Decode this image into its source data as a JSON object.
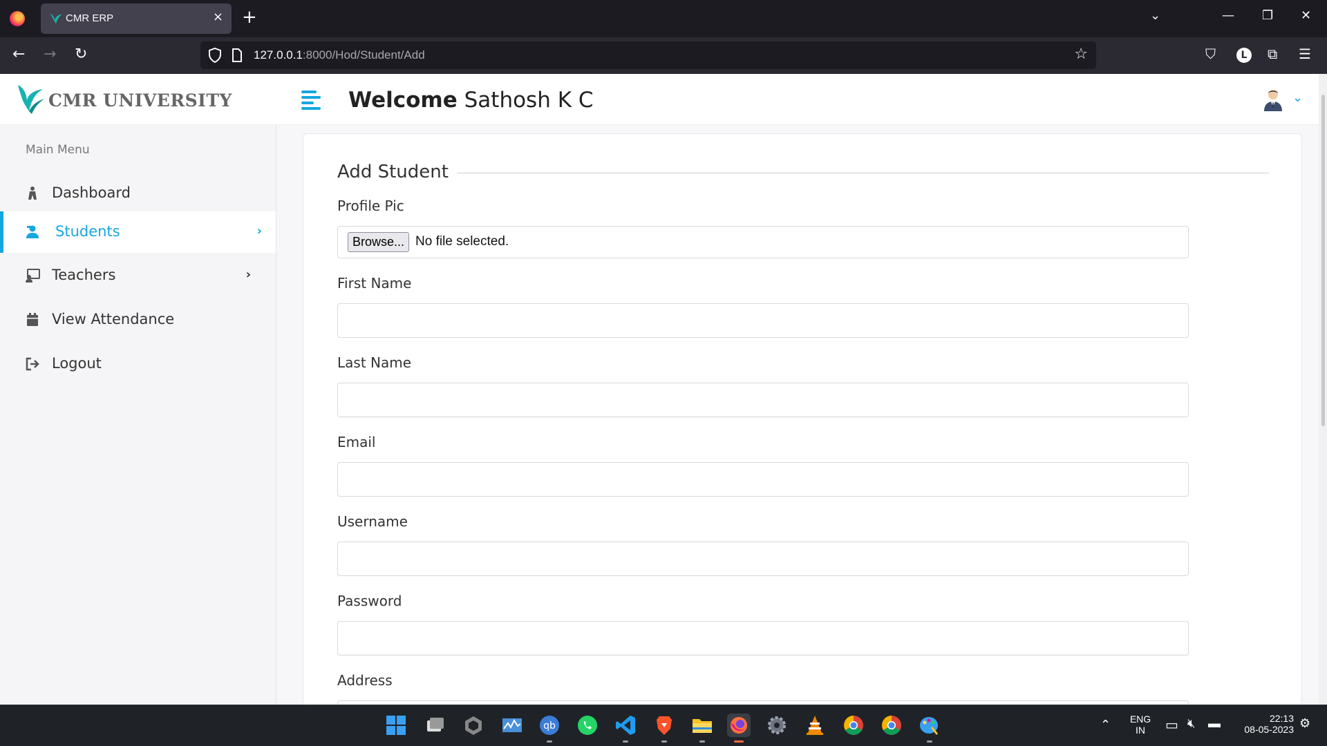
{
  "browser": {
    "tab_title": "CMR ERP",
    "tab_close": "×",
    "new_tab": "+",
    "url_host": "127.0.0.1",
    "url_rest": ":8000/Hod/Student/Add",
    "window_controls": {
      "list": "⌄",
      "minimize": "—",
      "restore": "❐",
      "close": "✕"
    }
  },
  "app": {
    "logo_text": "CMR UNIVERSITY",
    "brand_color": "#16a6e0",
    "sidebar": {
      "menu_title": "Main Menu",
      "items": [
        {
          "label": "Dashboard",
          "icon": "dashboard-icon",
          "has_chevron": false,
          "active": false
        },
        {
          "label": "Students",
          "icon": "students-icon",
          "has_chevron": true,
          "active": true
        },
        {
          "label": "Teachers",
          "icon": "teachers-icon",
          "has_chevron": true,
          "active": false
        },
        {
          "label": "View Attendance",
          "icon": "calendar-icon",
          "has_chevron": false,
          "active": false
        },
        {
          "label": "Logout",
          "icon": "logout-icon",
          "has_chevron": false,
          "active": false
        }
      ]
    },
    "header": {
      "welcome_bold": "Welcome",
      "user_name": "Sathosh K C"
    },
    "form": {
      "title": "Add Student",
      "profile_pic": {
        "label": "Profile Pic",
        "button": "Browse...",
        "status": "No file selected."
      },
      "fields": [
        {
          "label": "First Name",
          "value": ""
        },
        {
          "label": "Last Name",
          "value": ""
        },
        {
          "label": "Email",
          "value": ""
        },
        {
          "label": "Username",
          "value": ""
        },
        {
          "label": "Password",
          "value": ""
        },
        {
          "label": "Address",
          "value": ""
        }
      ]
    }
  },
  "taskbar": {
    "lang_top": "ENG",
    "lang_bottom": "IN",
    "time": "22:13",
    "date": "08-05-2023"
  }
}
